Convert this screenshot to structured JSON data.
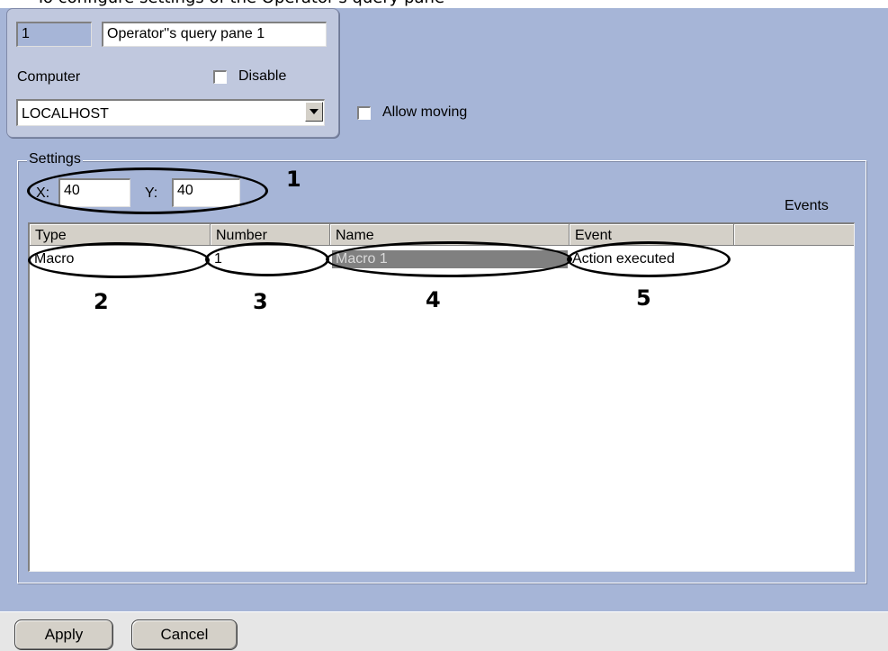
{
  "caption": {
    "text": "To configure settings of the Operator's query pane"
  },
  "object": {
    "id": "1",
    "name": "Operator''s query pane 1"
  },
  "computer": {
    "label": "Computer",
    "value": "LOCALHOST"
  },
  "disable": {
    "label": "Disable",
    "checked": false
  },
  "allow_moving": {
    "label": "Allow moving",
    "checked": false
  },
  "settings": {
    "legend": "Settings",
    "x_label": "X:",
    "x_value": "40",
    "y_label": "Y:",
    "y_value": "40",
    "events_label": "Events"
  },
  "events_table": {
    "columns": [
      "Type",
      "Number",
      "Name",
      "Event"
    ],
    "rows": [
      {
        "type": "Macro",
        "number": "1",
        "name": "Macro 1",
        "event": "Action executed"
      }
    ]
  },
  "annotations": [
    "1",
    "2",
    "3",
    "4",
    "5"
  ],
  "buttons": {
    "apply": "Apply",
    "cancel": "Cancel"
  },
  "colors": {
    "background": "#a6b5d7",
    "panel": "#c0c8de",
    "selected_cell": "#808080"
  }
}
